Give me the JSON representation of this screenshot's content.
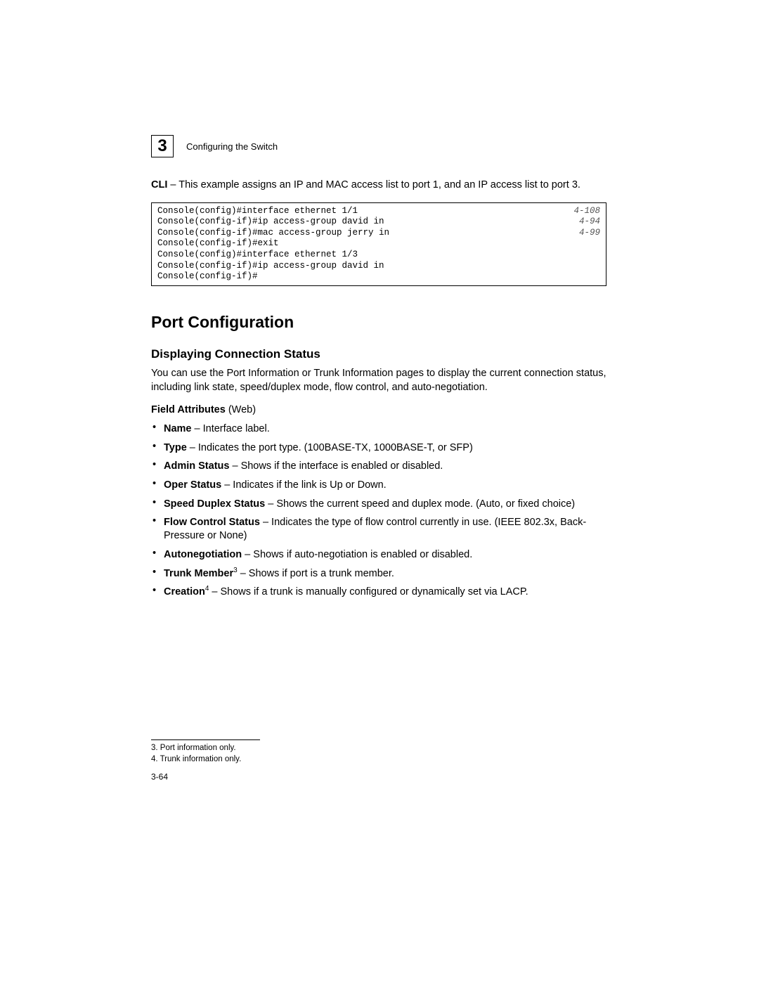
{
  "header": {
    "chapter_number": "3",
    "chapter_title": "Configuring the Switch"
  },
  "intro": {
    "prefix_bold": "CLI",
    "text": " – This example assigns an IP and MAC access list to port 1, and an IP access list to port 3."
  },
  "cli": [
    {
      "cmd": "Console(config)#interface ethernet 1/1",
      "ref": "4-108"
    },
    {
      "cmd": "Console(config-if)#ip access-group david in",
      "ref": "4-94"
    },
    {
      "cmd": "Console(config-if)#mac access-group jerry in",
      "ref": "4-99"
    },
    {
      "cmd": "Console(config-if)#exit",
      "ref": ""
    },
    {
      "cmd": "Console(config)#interface ethernet 1/3",
      "ref": ""
    },
    {
      "cmd": "Console(config-if)#ip access-group david in",
      "ref": ""
    },
    {
      "cmd": "Console(config-if)#",
      "ref": ""
    }
  ],
  "section": {
    "h1": "Port Configuration",
    "h2": "Displaying Connection Status",
    "intro": "You can use the Port Information or Trunk Information pages to display the current connection status, including link state, speed/duplex mode, flow control, and auto-negotiation.",
    "field_attributes_bold": "Field Attributes",
    "field_attributes_rest": " (Web)"
  },
  "attrs": [
    {
      "name": "Name",
      "sup": "",
      "desc": " – Interface label."
    },
    {
      "name": "Type",
      "sup": "",
      "desc": " – Indicates the port type. (100BASE-TX, 1000BASE-T, or SFP)"
    },
    {
      "name": "Admin Status",
      "sup": "",
      "desc": " – Shows if the interface is enabled or disabled."
    },
    {
      "name": "Oper Status",
      "sup": "",
      "desc": " – Indicates if the link is Up or Down."
    },
    {
      "name": "Speed Duplex Status",
      "sup": "",
      "desc": " – Shows the current speed and duplex mode. (Auto, or fixed choice)"
    },
    {
      "name": "Flow Control Status",
      "sup": "",
      "desc": " – Indicates the type of flow control currently in use. (IEEE 802.3x, Back-Pressure or None)"
    },
    {
      "name": "Autonegotiation",
      "sup": "",
      "desc": " – Shows if auto-negotiation is enabled or disabled."
    },
    {
      "name": "Trunk Member",
      "sup": "3",
      "desc": " – Shows if port is a trunk member."
    },
    {
      "name": "Creation",
      "sup": "4",
      "desc": " – Shows if a trunk is manually configured or dynamically set via LACP."
    }
  ],
  "footnotes": [
    "3.  Port information only.",
    "4.  Trunk information only."
  ],
  "page_number": "3-64"
}
